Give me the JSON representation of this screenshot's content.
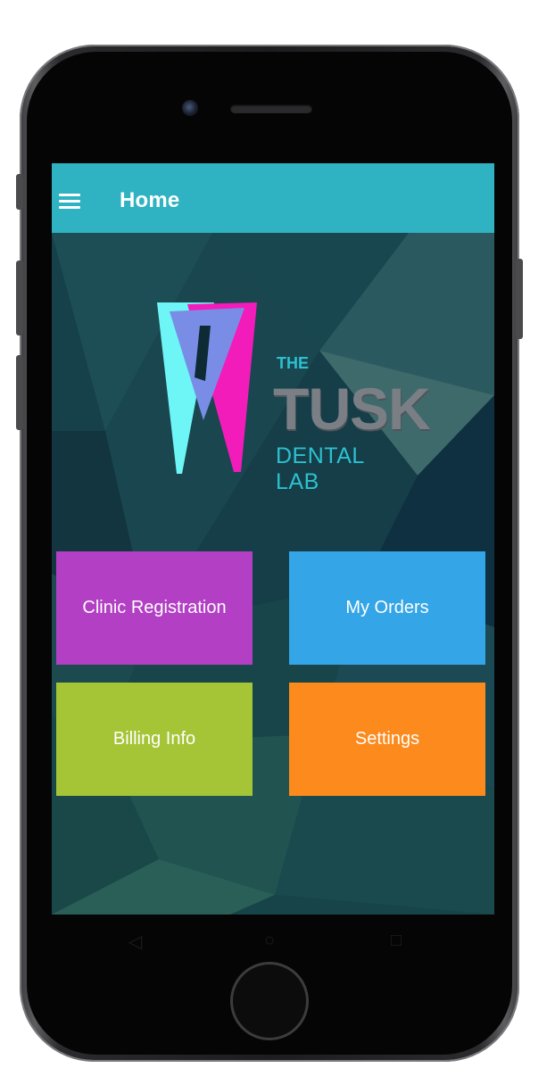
{
  "app": {
    "title": "Home",
    "menu_icon": "hamburger-menu-icon"
  },
  "logo": {
    "line1": "THE",
    "line2": "TUSK",
    "line3": "DENTAL LAB",
    "colors": {
      "cyan": "#6ef6f6",
      "magenta": "#f21cbb",
      "blue": "#7a8de6"
    }
  },
  "tiles": [
    {
      "label": "Clinic Registration",
      "color": "#b23fc4"
    },
    {
      "label": "My Orders",
      "color": "#34a5e6"
    },
    {
      "label": "Billing Info",
      "color": "#a5c436"
    },
    {
      "label": "Settings",
      "color": "#fc8a1c"
    }
  ],
  "colors": {
    "appbar": "#2fb2c1",
    "background": "#123a44"
  },
  "system_nav": {
    "back_icon": "back-triangle-icon",
    "home_icon": "home-circle-icon",
    "recents_icon": "recents-square-icon"
  }
}
